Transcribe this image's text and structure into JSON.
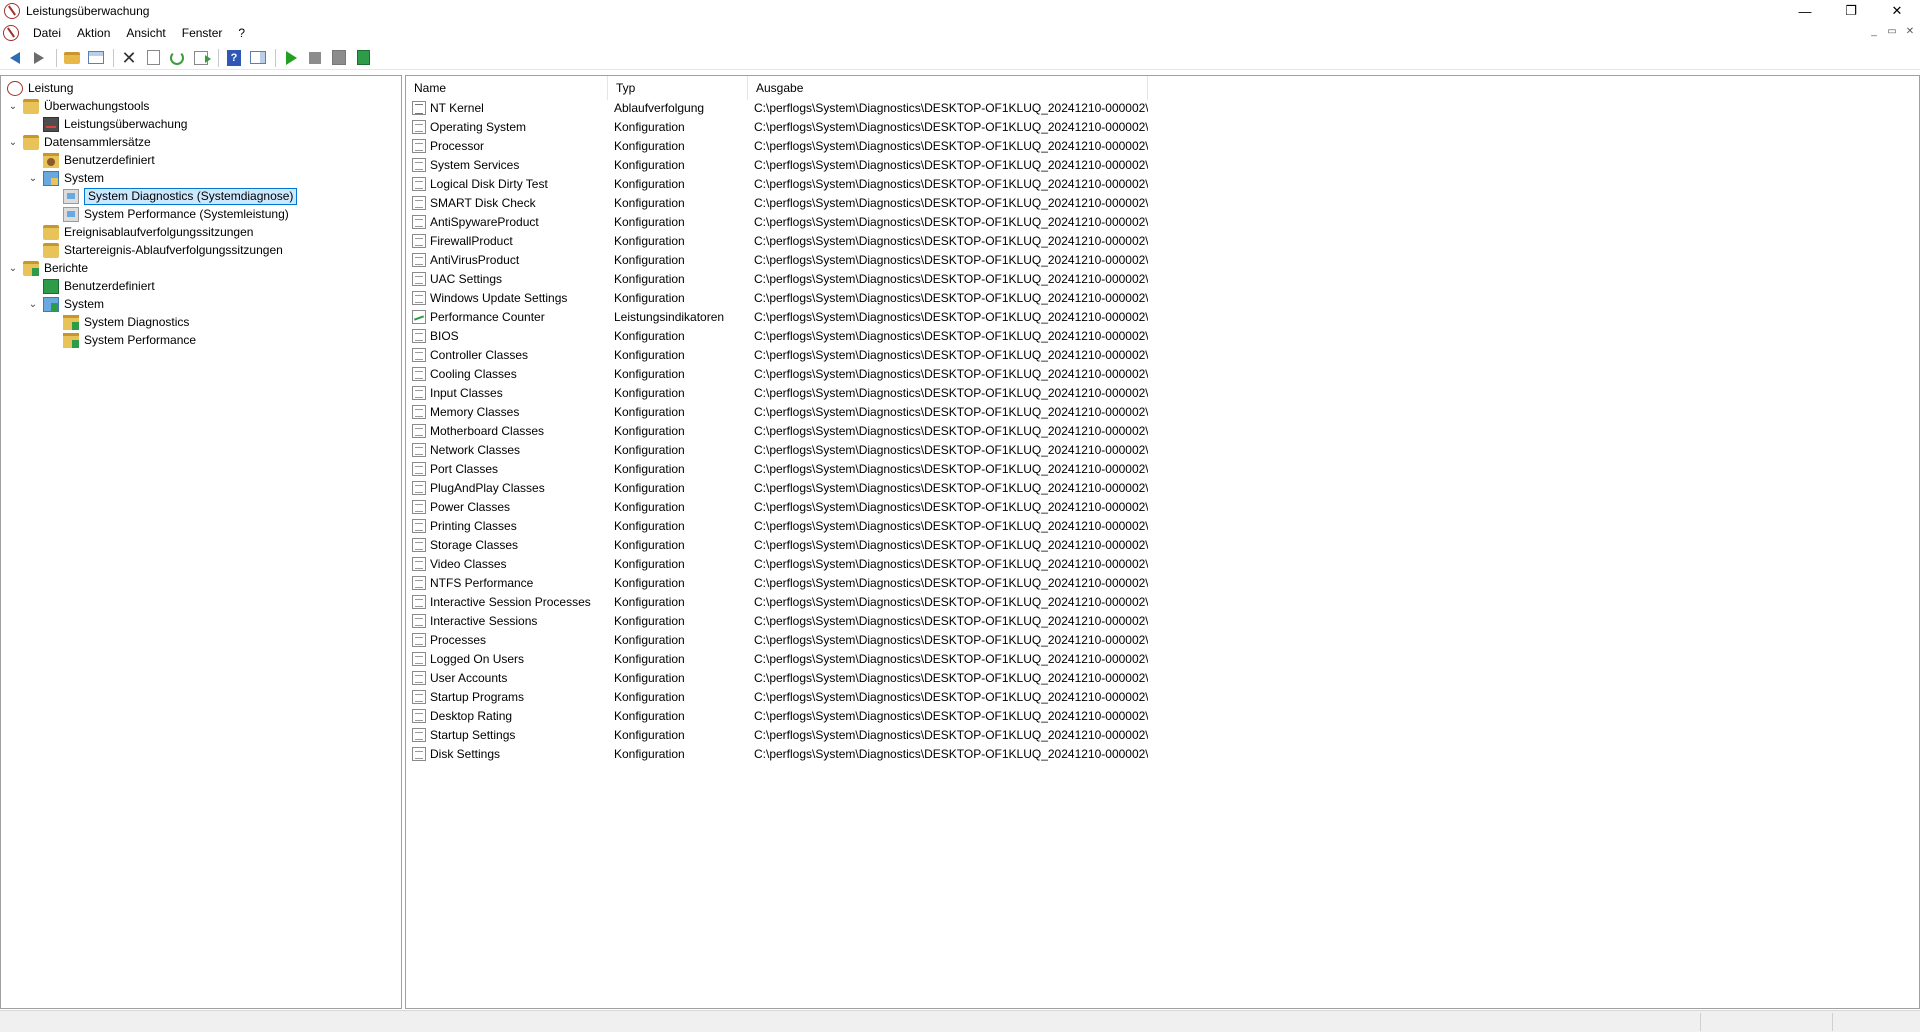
{
  "window": {
    "title": "Leistungsüberwachung",
    "minimize": "—",
    "restore": "❐",
    "close": "✕",
    "mdi_min": "_",
    "mdi_restore": "▭",
    "mdi_close": "✕"
  },
  "menu": [
    "Datei",
    "Aktion",
    "Ansicht",
    "Fenster",
    "?"
  ],
  "toolbar_icons": [
    "back-arrow-icon",
    "forward-arrow-icon",
    "up-folder-icon",
    "show-hide-console-tree-icon",
    "delete-icon",
    "properties-icon",
    "refresh-icon",
    "export-list-icon",
    "help-icon",
    "show-hide-action-pane-icon",
    "start-icon",
    "stop-icon",
    "latest-report-icon",
    "new-report-icon"
  ],
  "tree": {
    "root": "Leistung",
    "monitoring_tools": "Überwachungstools",
    "performance_monitor": "Leistungsüberwachung",
    "data_collector_sets": "Datensammlersätze",
    "dcs_user_defined": "Benutzerdefiniert",
    "dcs_system": "System",
    "sys_diag": "System Diagnostics (Systemdiagnose)",
    "sys_perf": "System Performance (Systemleistung)",
    "event_trace": "Ereignisablaufverfolgungssitzungen",
    "startup_trace": "Startereignis-Ablaufverfolgungssitzungen",
    "reports": "Berichte",
    "rep_user_defined": "Benutzerdefiniert",
    "rep_system": "System",
    "rep_sys_diag": "System Diagnostics",
    "rep_sys_perf": "System Performance",
    "expand_glyph": "⌄"
  },
  "columns": {
    "name": "Name",
    "type": "Typ",
    "output": "Ausgabe"
  },
  "rows": [
    {
      "name": "NT Kernel",
      "type": "Ablaufverfolgung",
      "output": "C:\\perflogs\\System\\Diagnostics\\DESKTOP-OF1KLUQ_20241210-000002\\..."
    },
    {
      "name": "Operating System",
      "type": "Konfiguration",
      "output": "C:\\perflogs\\System\\Diagnostics\\DESKTOP-OF1KLUQ_20241210-000002\\..."
    },
    {
      "name": "Processor",
      "type": "Konfiguration",
      "output": "C:\\perflogs\\System\\Diagnostics\\DESKTOP-OF1KLUQ_20241210-000002\\..."
    },
    {
      "name": "System Services",
      "type": "Konfiguration",
      "output": "C:\\perflogs\\System\\Diagnostics\\DESKTOP-OF1KLUQ_20241210-000002\\..."
    },
    {
      "name": "Logical Disk Dirty Test",
      "type": "Konfiguration",
      "output": "C:\\perflogs\\System\\Diagnostics\\DESKTOP-OF1KLUQ_20241210-000002\\..."
    },
    {
      "name": "SMART Disk Check",
      "type": "Konfiguration",
      "output": "C:\\perflogs\\System\\Diagnostics\\DESKTOP-OF1KLUQ_20241210-000002\\..."
    },
    {
      "name": "AntiSpywareProduct",
      "type": "Konfiguration",
      "output": "C:\\perflogs\\System\\Diagnostics\\DESKTOP-OF1KLUQ_20241210-000002\\..."
    },
    {
      "name": "FirewallProduct",
      "type": "Konfiguration",
      "output": "C:\\perflogs\\System\\Diagnostics\\DESKTOP-OF1KLUQ_20241210-000002\\..."
    },
    {
      "name": "AntiVirusProduct",
      "type": "Konfiguration",
      "output": "C:\\perflogs\\System\\Diagnostics\\DESKTOP-OF1KLUQ_20241210-000002\\..."
    },
    {
      "name": "UAC Settings",
      "type": "Konfiguration",
      "output": "C:\\perflogs\\System\\Diagnostics\\DESKTOP-OF1KLUQ_20241210-000002\\..."
    },
    {
      "name": "Windows Update Settings",
      "type": "Konfiguration",
      "output": "C:\\perflogs\\System\\Diagnostics\\DESKTOP-OF1KLUQ_20241210-000002\\..."
    },
    {
      "name": "Performance Counter",
      "type": "Leistungsindikatoren",
      "output": "C:\\perflogs\\System\\Diagnostics\\DESKTOP-OF1KLUQ_20241210-000002\\..."
    },
    {
      "name": "BIOS",
      "type": "Konfiguration",
      "output": "C:\\perflogs\\System\\Diagnostics\\DESKTOP-OF1KLUQ_20241210-000002\\..."
    },
    {
      "name": "Controller Classes",
      "type": "Konfiguration",
      "output": "C:\\perflogs\\System\\Diagnostics\\DESKTOP-OF1KLUQ_20241210-000002\\..."
    },
    {
      "name": "Cooling Classes",
      "type": "Konfiguration",
      "output": "C:\\perflogs\\System\\Diagnostics\\DESKTOP-OF1KLUQ_20241210-000002\\..."
    },
    {
      "name": "Input Classes",
      "type": "Konfiguration",
      "output": "C:\\perflogs\\System\\Diagnostics\\DESKTOP-OF1KLUQ_20241210-000002\\..."
    },
    {
      "name": "Memory Classes",
      "type": "Konfiguration",
      "output": "C:\\perflogs\\System\\Diagnostics\\DESKTOP-OF1KLUQ_20241210-000002\\..."
    },
    {
      "name": "Motherboard Classes",
      "type": "Konfiguration",
      "output": "C:\\perflogs\\System\\Diagnostics\\DESKTOP-OF1KLUQ_20241210-000002\\..."
    },
    {
      "name": "Network Classes",
      "type": "Konfiguration",
      "output": "C:\\perflogs\\System\\Diagnostics\\DESKTOP-OF1KLUQ_20241210-000002\\..."
    },
    {
      "name": "Port Classes",
      "type": "Konfiguration",
      "output": "C:\\perflogs\\System\\Diagnostics\\DESKTOP-OF1KLUQ_20241210-000002\\..."
    },
    {
      "name": "PlugAndPlay Classes",
      "type": "Konfiguration",
      "output": "C:\\perflogs\\System\\Diagnostics\\DESKTOP-OF1KLUQ_20241210-000002\\..."
    },
    {
      "name": "Power Classes",
      "type": "Konfiguration",
      "output": "C:\\perflogs\\System\\Diagnostics\\DESKTOP-OF1KLUQ_20241210-000002\\..."
    },
    {
      "name": "Printing Classes",
      "type": "Konfiguration",
      "output": "C:\\perflogs\\System\\Diagnostics\\DESKTOP-OF1KLUQ_20241210-000002\\..."
    },
    {
      "name": "Storage Classes",
      "type": "Konfiguration",
      "output": "C:\\perflogs\\System\\Diagnostics\\DESKTOP-OF1KLUQ_20241210-000002\\..."
    },
    {
      "name": "Video Classes",
      "type": "Konfiguration",
      "output": "C:\\perflogs\\System\\Diagnostics\\DESKTOP-OF1KLUQ_20241210-000002\\..."
    },
    {
      "name": "NTFS Performance",
      "type": "Konfiguration",
      "output": "C:\\perflogs\\System\\Diagnostics\\DESKTOP-OF1KLUQ_20241210-000002\\..."
    },
    {
      "name": "Interactive Session Processes",
      "type": "Konfiguration",
      "output": "C:\\perflogs\\System\\Diagnostics\\DESKTOP-OF1KLUQ_20241210-000002\\..."
    },
    {
      "name": "Interactive Sessions",
      "type": "Konfiguration",
      "output": "C:\\perflogs\\System\\Diagnostics\\DESKTOP-OF1KLUQ_20241210-000002\\..."
    },
    {
      "name": "Processes",
      "type": "Konfiguration",
      "output": "C:\\perflogs\\System\\Diagnostics\\DESKTOP-OF1KLUQ_20241210-000002\\..."
    },
    {
      "name": "Logged On Users",
      "type": "Konfiguration",
      "output": "C:\\perflogs\\System\\Diagnostics\\DESKTOP-OF1KLUQ_20241210-000002\\..."
    },
    {
      "name": "User Accounts",
      "type": "Konfiguration",
      "output": "C:\\perflogs\\System\\Diagnostics\\DESKTOP-OF1KLUQ_20241210-000002\\..."
    },
    {
      "name": "Startup Programs",
      "type": "Konfiguration",
      "output": "C:\\perflogs\\System\\Diagnostics\\DESKTOP-OF1KLUQ_20241210-000002\\..."
    },
    {
      "name": "Desktop Rating",
      "type": "Konfiguration",
      "output": "C:\\perflogs\\System\\Diagnostics\\DESKTOP-OF1KLUQ_20241210-000002\\..."
    },
    {
      "name": "Startup Settings",
      "type": "Konfiguration",
      "output": "C:\\perflogs\\System\\Diagnostics\\DESKTOP-OF1KLUQ_20241210-000002\\..."
    },
    {
      "name": "Disk Settings",
      "type": "Konfiguration",
      "output": "C:\\perflogs\\System\\Diagnostics\\DESKTOP-OF1KLUQ_20241210-000002\\..."
    }
  ]
}
